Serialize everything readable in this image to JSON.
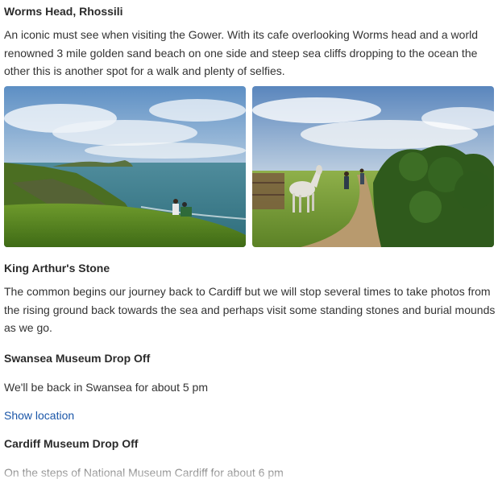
{
  "sections": [
    {
      "title": "Worms Head, Rhossili",
      "text": "An iconic must see when visiting the Gower. With its cafe overlooking Worms head and a world renowned 3 mile golden sand beach on one side and steep sea cliffs dropping to the ocean the other this is another spot for a walk and plenty of selfies."
    },
    {
      "title": "King Arthur's Stone",
      "text": "The common begins our journey back to Cardiff but we will stop several times to take photos from the rising ground back towards the sea and perhaps visit some standing stones and burial mounds as we go."
    },
    {
      "title": "Swansea Museum Drop Off",
      "text": "We'll be back in Swansea for about 5 pm",
      "link": "Show location"
    },
    {
      "title": "Cardiff Museum Drop Off",
      "text": "On the steps of National Museum Cardiff for about 6 pm"
    }
  ],
  "colors": {
    "link": "#1a56a8",
    "heading": "#2b2b2b",
    "body_text": "#333333"
  }
}
